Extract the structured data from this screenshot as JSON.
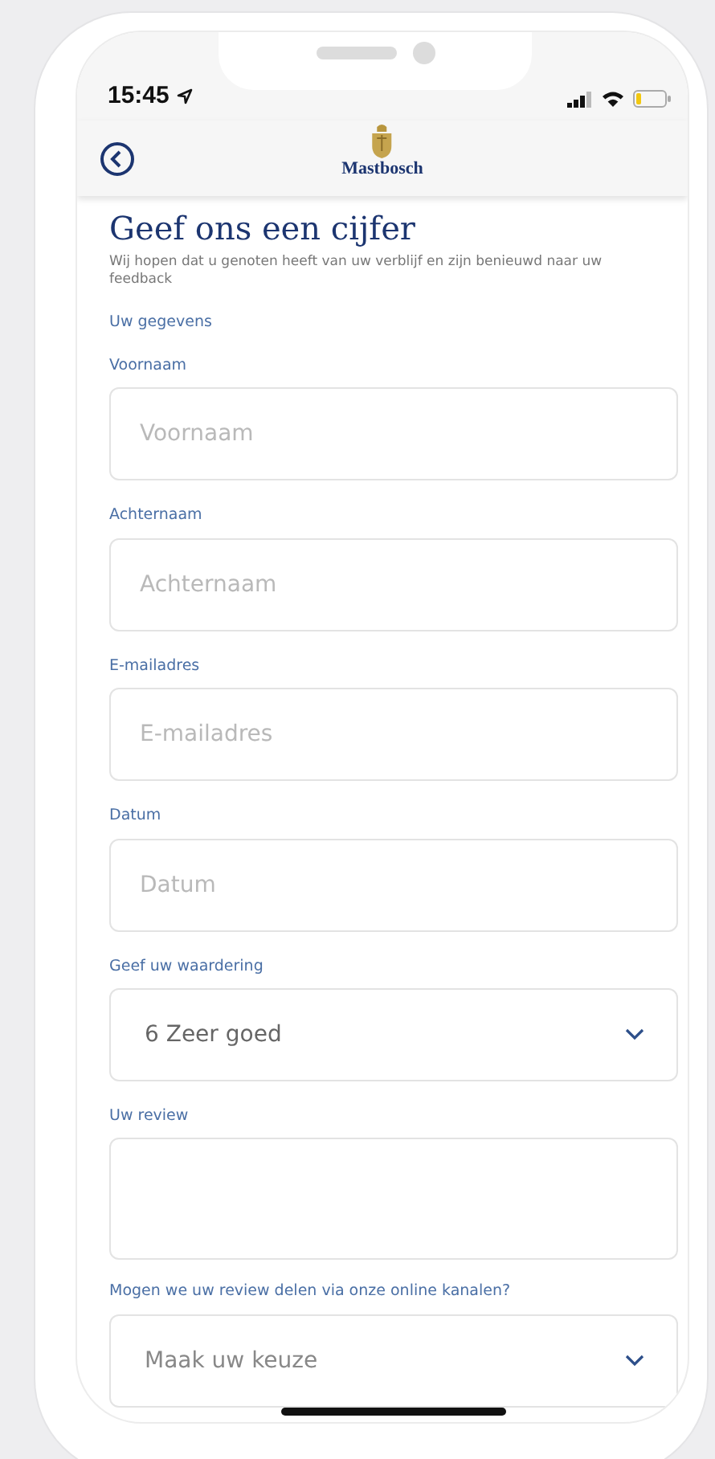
{
  "status_bar": {
    "time": "15:45"
  },
  "header": {
    "logo_text": "Mastbosch"
  },
  "title": "Geef ons een cijfer",
  "intro": "Wij hopen dat u genoten heeft van uw verblijf en zijn benieuwd naar uw feedback",
  "section": "Uw gegevens",
  "fields": [
    {
      "kind": "text",
      "label": "Voornaam",
      "placeholder": "Voornaam"
    },
    {
      "kind": "text",
      "label": "Achternaam",
      "placeholder": "Achternaam"
    },
    {
      "kind": "text",
      "label": "E-mailadres",
      "placeholder": "E-mailadres"
    },
    {
      "kind": "text",
      "label": "Datum",
      "placeholder": "Datum"
    },
    {
      "kind": "select",
      "label": "Geef uw waardering",
      "value": "6 Zeer goed"
    },
    {
      "kind": "textarea",
      "label": "Uw review"
    },
    {
      "kind": "select",
      "label": "Mogen we uw review delen via onze online kanalen?",
      "placeholder": "Maak uw keuze"
    }
  ]
}
